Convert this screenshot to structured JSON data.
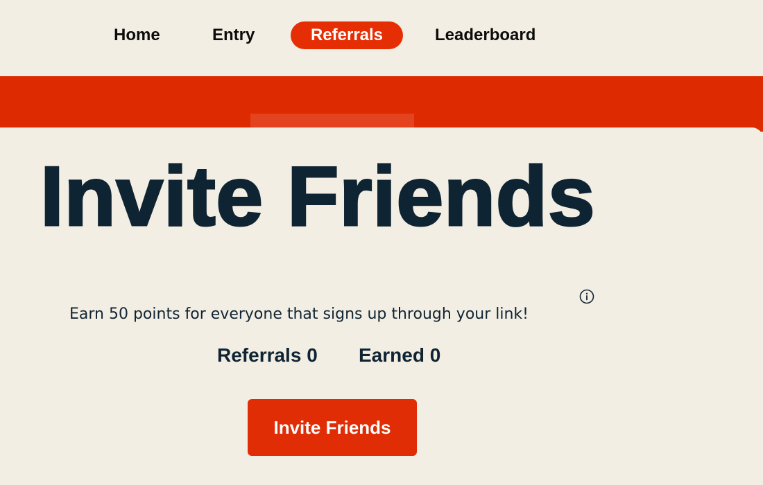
{
  "nav": {
    "items": [
      {
        "label": "Home"
      },
      {
        "label": "Entry"
      },
      {
        "label": "Referrals",
        "active": true
      },
      {
        "label": "Leaderboard"
      }
    ],
    "active_color": "#e62e04"
  },
  "hero": {
    "title": "Invite Friends",
    "band_color": "#de2a00"
  },
  "description": {
    "text": "Earn 50 points for everyone that signs up through your link!",
    "info_icon": "info-circle-icon"
  },
  "stats": {
    "referrals": {
      "label": "Referrals",
      "value": "0"
    },
    "earned": {
      "label": "Earned",
      "value": "0"
    }
  },
  "cta": {
    "label": "Invite Friends",
    "color": "#e02d06"
  }
}
